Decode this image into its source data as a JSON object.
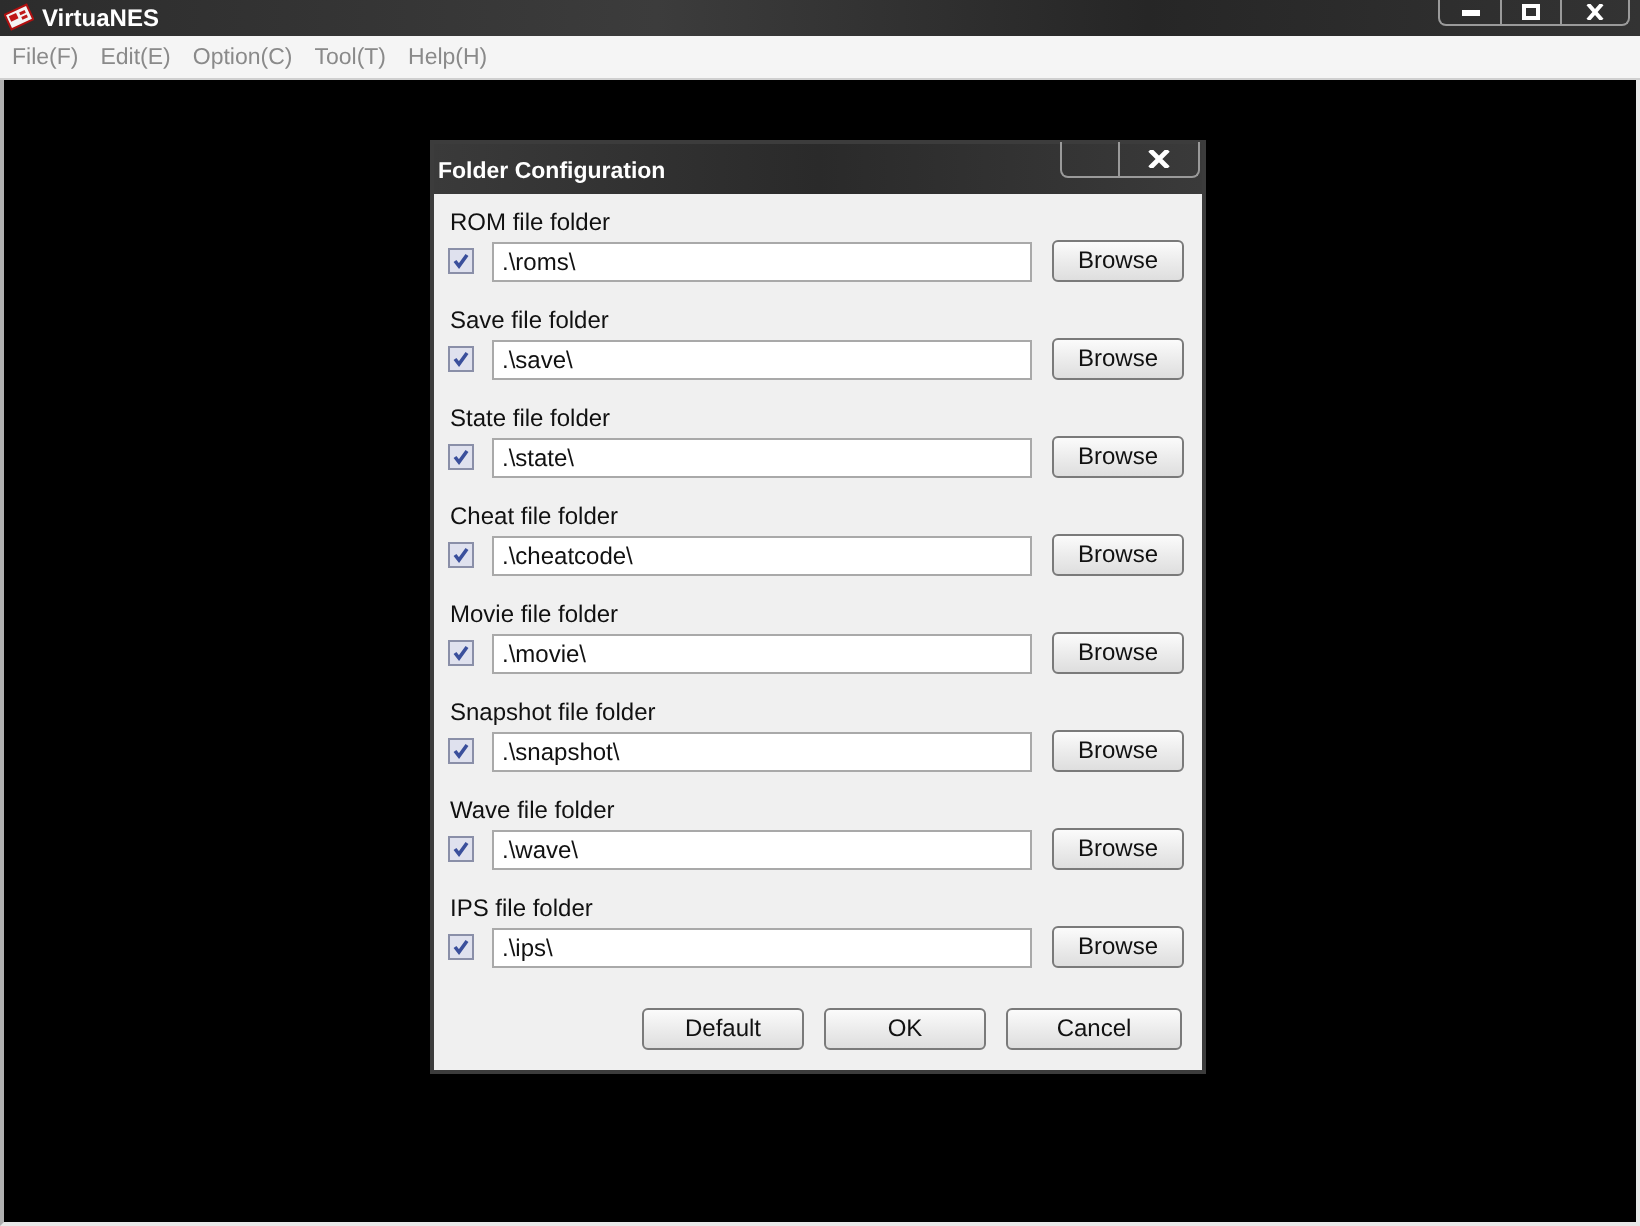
{
  "window": {
    "title": "VirtuaNES"
  },
  "menu": [
    {
      "label": "File(F)"
    },
    {
      "label": "Edit(E)"
    },
    {
      "label": "Option(C)"
    },
    {
      "label": "Tool(T)"
    },
    {
      "label": "Help(H)"
    }
  ],
  "dialog": {
    "title": "Folder Configuration",
    "folders": [
      {
        "label": "ROM file folder",
        "checked": true,
        "path": ".\\roms\\",
        "button": "Browse"
      },
      {
        "label": "Save file folder",
        "checked": true,
        "path": ".\\save\\",
        "button": "Browse"
      },
      {
        "label": "State file folder",
        "checked": true,
        "path": ".\\state\\",
        "button": "Browse"
      },
      {
        "label": "Cheat file folder",
        "checked": true,
        "path": ".\\cheatcode\\",
        "button": "Browse"
      },
      {
        "label": "Movie file folder",
        "checked": true,
        "path": ".\\movie\\",
        "button": "Browse"
      },
      {
        "label": "Snapshot file folder",
        "checked": true,
        "path": ".\\snapshot\\",
        "button": "Browse"
      },
      {
        "label": "Wave file folder",
        "checked": true,
        "path": ".\\wave\\",
        "button": "Browse"
      },
      {
        "label": "IPS file folder",
        "checked": true,
        "path": ".\\ips\\",
        "button": "Browse"
      }
    ],
    "buttons": [
      {
        "label": "Default"
      },
      {
        "label": "OK"
      },
      {
        "label": "Cancel"
      }
    ]
  }
}
